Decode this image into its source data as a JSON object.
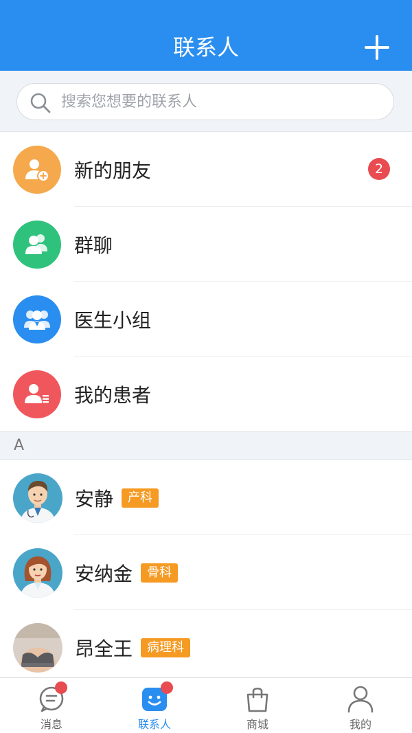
{
  "header": {
    "title": "联系人",
    "add_icon": "plus-icon"
  },
  "search": {
    "placeholder": "搜索您想要的联系人",
    "value": ""
  },
  "menu": [
    {
      "label": "新的朋友",
      "icon": "add-user-icon",
      "color": "#f5a94c",
      "badge": "2"
    },
    {
      "label": "群聊",
      "icon": "group-icon",
      "color": "#2fc27c"
    },
    {
      "label": "医生小组",
      "icon": "doctor-team-icon",
      "color": "#2a8ef0"
    },
    {
      "label": "我的患者",
      "icon": "patient-card-icon",
      "color": "#f0575c"
    }
  ],
  "section": {
    "letter": "A"
  },
  "contacts": [
    {
      "name": "安静",
      "tag": "产科"
    },
    {
      "name": "安纳金",
      "tag": "骨科"
    },
    {
      "name": "昂全王",
      "tag": "病理科"
    }
  ],
  "tabbar": {
    "tabs": [
      {
        "label": "消息",
        "icon": "message-icon"
      },
      {
        "label": "联系人",
        "icon": "contacts-icon"
      },
      {
        "label": "商城",
        "icon": "shopping-bag-icon"
      },
      {
        "label": "我的",
        "icon": "profile-icon"
      }
    ],
    "active": "联系人"
  },
  "colors": {
    "primary": "#2a8ef0",
    "badge": "#e84b50",
    "tag": "#f59a23"
  }
}
